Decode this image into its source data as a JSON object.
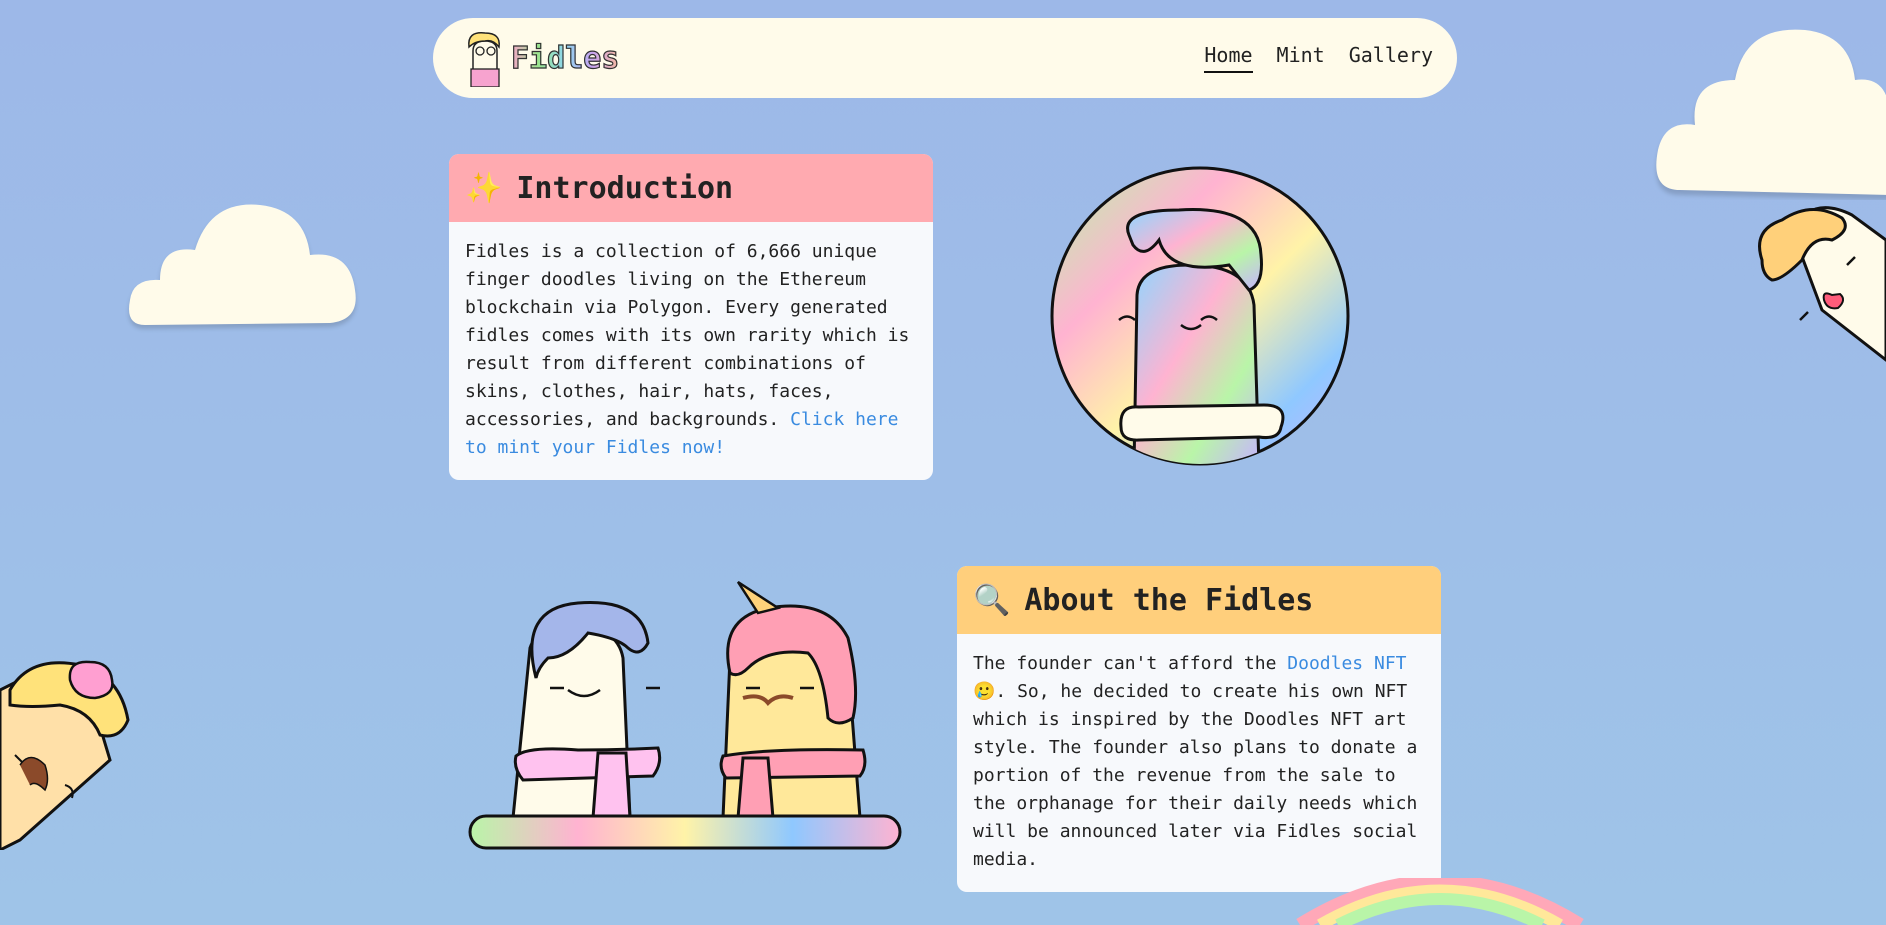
{
  "brand": {
    "name": "Fidles"
  },
  "nav": {
    "links": [
      {
        "label": "Home",
        "active": true
      },
      {
        "label": "Mint",
        "active": false
      },
      {
        "label": "Gallery",
        "active": false
      }
    ]
  },
  "intro": {
    "emoji": "✨",
    "title": "Introduction",
    "body": "Fidles is a collection of 6,666 unique finger doodles living on the Ethereum blockchain via Polygon. Every generated fidles comes with its own rarity which is result from different combinations of skins, clothes, hair, hats, faces, accessories, and backgrounds. ",
    "link": "Click here to mint your Fidles now!"
  },
  "about": {
    "emoji": "🔍",
    "title": "About the Fidles",
    "body_before": "The founder can't afford the ",
    "link": "Doodles NFT",
    "body_after": " 🥲. So, he decided to create his own NFT which is inspired by the Doodles NFT art style. The founder also plans to donate a portion of the revenue from the sale to the orphanage for their daily needs which will be announced later via Fidles social media."
  },
  "colors": {
    "intro_header": "#ffaab0",
    "about_header": "#ffcf7c",
    "navbar_bg": "#fffbea",
    "link": "#3a8be0"
  }
}
